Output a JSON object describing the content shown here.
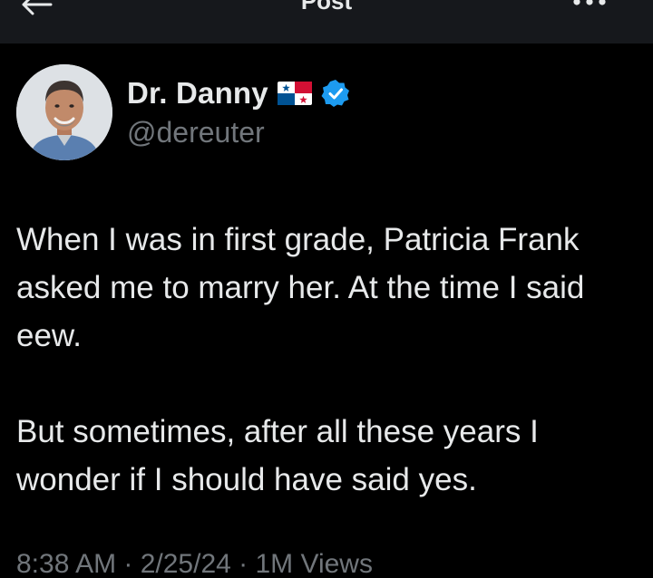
{
  "header": {
    "title": "Post",
    "back_icon": "arrow-left-icon",
    "more_icon": "more-horizontal-icon"
  },
  "author": {
    "name": "Dr. Danny",
    "handle": "@dereuter",
    "flag_icon": "panama-flag-icon",
    "verified_icon": "verified-badge-icon",
    "verified_color": "#1d9bf0"
  },
  "tweet": {
    "paragraph1": "When I was in first grade, Patricia Frank asked me to marry her. At the time I said eew.",
    "paragraph2": "But sometimes, after all these years I wonder if I should have said yes."
  },
  "meta": {
    "timestamp_fragment": "8:38 AM · 2/25/24 · 1M Views"
  },
  "colors": {
    "background": "#000000",
    "header_background": "#16181c",
    "text_primary": "#e7e9ea",
    "text_secondary": "#71767b"
  }
}
